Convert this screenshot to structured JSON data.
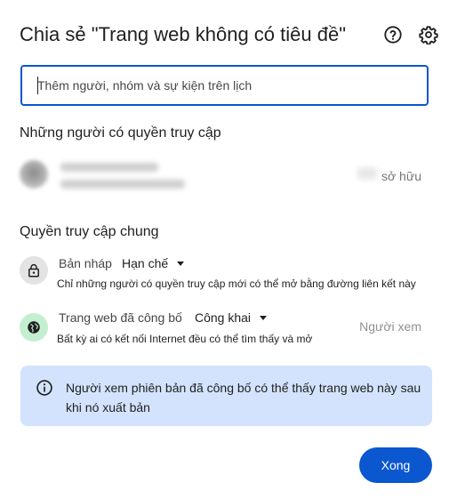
{
  "dialog": {
    "title": "Chia sẻ \"Trang web không có tiêu đề\"",
    "icons": {
      "help": "help-circle-icon",
      "settings": "gear-icon"
    }
  },
  "share_input": {
    "placeholder": "Thêm người, nhóm và sự kiện trên lịch",
    "value": ""
  },
  "people_section": {
    "heading": "Những người có quyền truy cập",
    "people": [
      {
        "name": "",
        "email": "",
        "role": "sở hữu"
      }
    ]
  },
  "general_access": {
    "heading": "Quyền truy cập chung",
    "rows": [
      {
        "icon": "lock-icon",
        "label": "Bản nháp",
        "value": "Hạn chế",
        "description": "Chỉ những người có quyền truy cập mới có thể mở bằng đường liên kết này",
        "role": ""
      },
      {
        "icon": "globe-icon",
        "label": "Trang web đã công bố",
        "value": "Công khai",
        "description": "Bất kỳ ai có kết nối Internet đều có thể tìm thấy và mở",
        "role": "Người xem"
      }
    ]
  },
  "info_banner": {
    "icon": "info-icon",
    "text": "Người xem phiên bản đã công bố có thể thấy trang web này sau khi nó xuất bản"
  },
  "footer": {
    "done_label": "Xong"
  },
  "colors": {
    "primary": "#0b57d0",
    "info_bg": "#d3e3fd",
    "globe_bg": "#c4eed0",
    "lock_bg": "#e3e3e3"
  }
}
